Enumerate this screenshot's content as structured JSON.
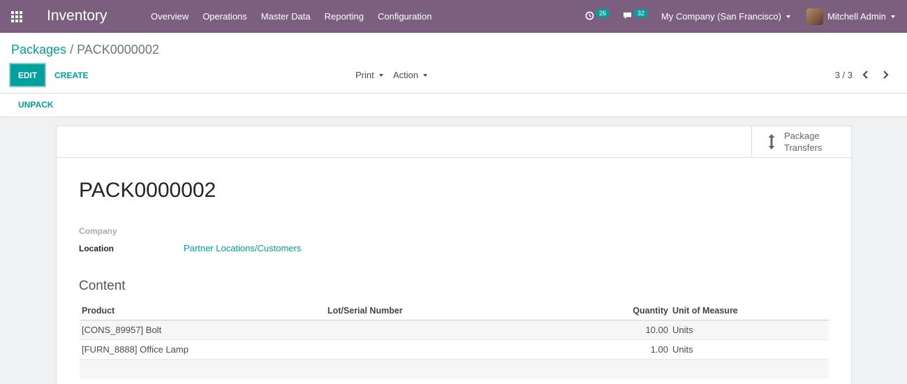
{
  "navbar": {
    "app_title": "Inventory",
    "menu": [
      "Overview",
      "Operations",
      "Master Data",
      "Reporting",
      "Configuration"
    ],
    "activity_count": "26",
    "message_count": "32",
    "company": "My Company (San Francisco)",
    "user": "Mitchell Admin",
    "color": "#7c5f7e"
  },
  "breadcrumb": {
    "parent": "Packages",
    "current": "PACK0000002"
  },
  "controls": {
    "edit": "EDIT",
    "create": "CREATE",
    "print": "Print",
    "action": "Action",
    "pager": "3 / 3",
    "accent": "#00a09d"
  },
  "statusbar": {
    "unpack": "UNPACK"
  },
  "smart_button": {
    "line1": "Package",
    "line2": "Transfers",
    "icon": "arrows-v-icon"
  },
  "record": {
    "name": "PACK0000002",
    "company_label": "Company",
    "location_label": "Location",
    "location_value": "Partner Locations/Customers",
    "content_title": "Content"
  },
  "table": {
    "headers": [
      "Product",
      "Lot/Serial Number",
      "Quantity",
      "Unit of Measure"
    ],
    "rows": [
      {
        "product": "[CONS_89957] Bolt",
        "lot": "",
        "quantity": "10.00",
        "uom": "Units"
      },
      {
        "product": "[FURN_8888] Office Lamp",
        "lot": "",
        "quantity": "1.00",
        "uom": "Units"
      }
    ]
  }
}
